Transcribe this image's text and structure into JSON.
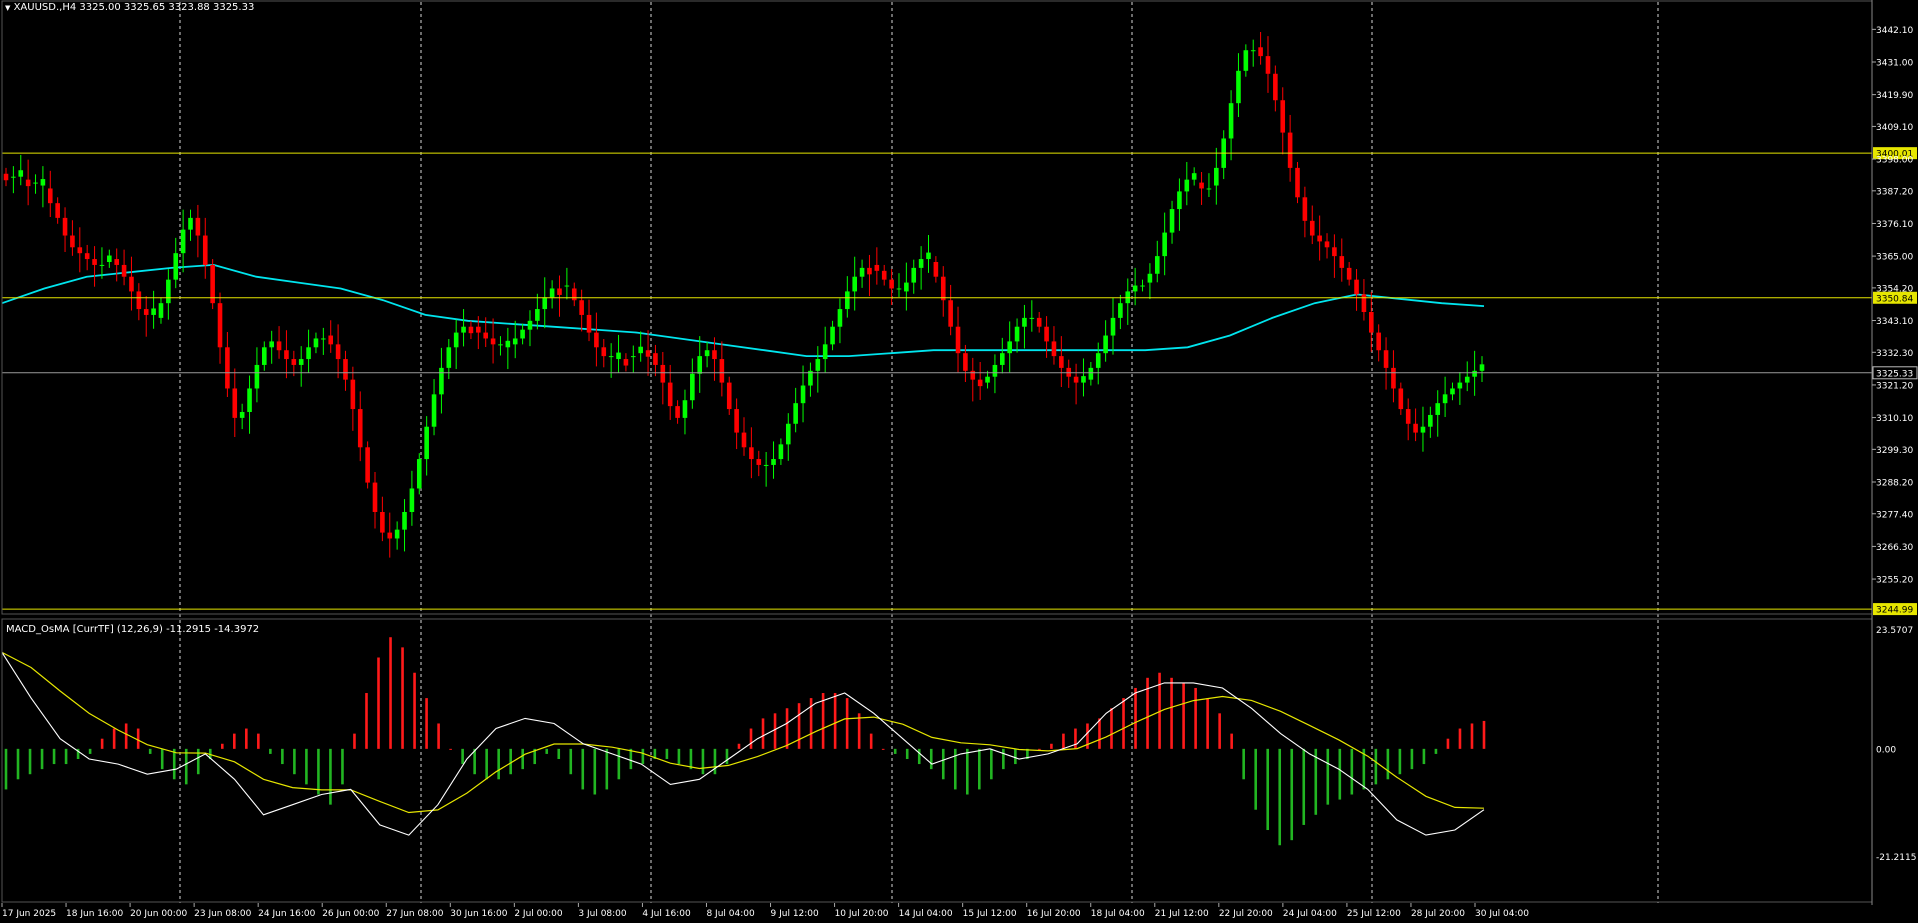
{
  "header": {
    "symbol_line": "XAUUSD.,H4  3325.00 3325.65 3323.88 3325.33",
    "indicator_line": "MACD_OsMA [CurrTF] (12,26,9) -11.2915 -14.3972"
  },
  "colors": {
    "background": "#000000",
    "bull": "#00ff00",
    "bear": "#ff0000",
    "ma": "#00e5ee",
    "level_line": "#e6e600",
    "grid": "#ffffff",
    "axis_text": "#ffffff",
    "macd_line": "#ffffff",
    "signal_line": "#e6e600",
    "hist_up": "#ff1a1a",
    "hist_down": "#22b522"
  },
  "chart_data": [
    {
      "type": "candlestick",
      "symbol": "XAUUSD.",
      "timeframe": "H4",
      "ylim": [
        3244.0,
        3448.0
      ],
      "y_ticks": [
        "3442.10",
        "3431.00",
        "3419.90",
        "3409.10",
        "3398.00",
        "3387.20",
        "3376.10",
        "3365.00",
        "3354.20",
        "3343.10",
        "3332.30",
        "3321.20",
        "3310.10",
        "3299.30",
        "3288.20",
        "3277.40",
        "3266.30",
        "3255.20"
      ],
      "x_labels": [
        "17 Jun 2025",
        "18 Jun 16:00",
        "20 Jun 00:00",
        "23 Jun 08:00",
        "24 Jun 16:00",
        "26 Jun 00:00",
        "27 Jun 08:00",
        "30 Jun 16:00",
        "2 Jul 00:00",
        "3 Jul 08:00",
        "4 Jul 16:00",
        "8 Jul 04:00",
        "9 Jul 12:00",
        "10 Jul 20:00",
        "14 Jul 04:00",
        "15 Jul 12:00",
        "16 Jul 20:00",
        "18 Jul 04:00",
        "21 Jul 12:00",
        "22 Jul 20:00",
        "24 Jul 04:00",
        "25 Jul 12:00",
        "28 Jul 20:00",
        "30 Jul 04:00"
      ],
      "horizontal_levels": [
        {
          "value": 3400.01,
          "label": "3400.01"
        },
        {
          "value": 3350.84,
          "label": "3350.84"
        },
        {
          "value": 3244.99,
          "label": "3244.99"
        }
      ],
      "current_price": {
        "value": 3325.33,
        "label": "3325.33"
      },
      "ohlc_anchors": [
        3392,
        3392,
        3391,
        3390,
        3389,
        3388,
        3383,
        3378,
        3372,
        3368,
        3366,
        3364,
        3362,
        3363,
        3364,
        3362,
        3358,
        3353,
        3347,
        3345,
        3344,
        3349,
        3357,
        3366,
        3374,
        3378,
        3372,
        3362,
        3349,
        3334,
        3320,
        3310,
        3312,
        3320,
        3328,
        3334,
        3336,
        3333,
        3330,
        3328,
        3330,
        3334,
        3337,
        3338,
        3335,
        3330,
        3323,
        3313,
        3300,
        3288,
        3278,
        3271,
        3269,
        3272,
        3278,
        3286,
        3296,
        3307,
        3318,
        3327,
        3334,
        3339,
        3341,
        3341,
        3339,
        3337,
        3335,
        3334,
        3335,
        3337,
        3340,
        3343,
        3347,
        3351,
        3354,
        3355,
        3354,
        3350,
        3345,
        3339,
        3334,
        3331,
        3330,
        3330,
        3331,
        3332,
        3333,
        3332,
        3328,
        3322,
        3314,
        3310,
        3316,
        3325,
        3331,
        3333,
        3330,
        3322,
        3313,
        3305,
        3300,
        3296,
        3294,
        3294,
        3296,
        3301,
        3308,
        3315,
        3321,
        3326,
        3330,
        3335,
        3341,
        3347,
        3353,
        3358,
        3361,
        3362,
        3360,
        3357,
        3354,
        3353,
        3356,
        3361,
        3364,
        3363,
        3358,
        3350,
        3341,
        3332,
        3326,
        3323,
        3322,
        3324,
        3328,
        3332,
        3336,
        3341,
        3344,
        3344,
        3341,
        3336,
        3331,
        3327,
        3324,
        3322,
        3323,
        3327,
        3332,
        3338,
        3344,
        3349,
        3353,
        3355,
        3356,
        3359,
        3365,
        3373,
        3381,
        3387,
        3391,
        3390,
        3388,
        3389,
        3395,
        3405,
        3417,
        3428,
        3435,
        3436,
        3433,
        3427,
        3418,
        3407,
        3395,
        3385,
        3377,
        3372,
        3370,
        3368,
        3365,
        3361,
        3357,
        3352,
        3346,
        3339,
        3333,
        3327,
        3320,
        3313,
        3308,
        3305,
        3307,
        3311,
        3315,
        3318,
        3320,
        3322,
        3324,
        3326,
        3325
      ],
      "moving_average_anchors": [
        3349,
        3354,
        3358,
        3359.5,
        3361,
        3362,
        3358,
        3356,
        3354,
        3350,
        3345,
        3343,
        3342,
        3341,
        3340,
        3339,
        3337,
        3335,
        3333,
        3331,
        3331,
        3332,
        3333,
        3333,
        3333,
        3333,
        3333,
        3333,
        3334,
        3338,
        3344,
        3349,
        3352,
        3350.5,
        3349,
        3348
      ]
    },
    {
      "type": "histogram+lines",
      "name": "MACD_OsMA [CurrTF] (12,26,9)",
      "values_shown": [
        -11.2915,
        -14.3972
      ],
      "ylim": [
        -22.5,
        25.0
      ],
      "y_ticks": [
        "23.5707",
        "0.00",
        "-21.2115"
      ],
      "histogram_anchors": [
        -8,
        -6,
        -5,
        -4,
        -3,
        -3,
        -2,
        -1,
        2,
        4,
        5,
        4,
        -1,
        -4,
        -6,
        -7,
        -5,
        -2,
        1,
        3,
        4,
        3,
        -1,
        -3,
        -5,
        -7,
        -9,
        -11,
        -7,
        3,
        11,
        18,
        22,
        20,
        15,
        10,
        5,
        0,
        -3,
        -5,
        -6,
        -6,
        -5,
        -4,
        -3,
        -1,
        -2,
        -5,
        -8,
        -9,
        -8,
        -6,
        -4,
        -3,
        -2,
        -2,
        -3,
        -4,
        -5,
        -5,
        -3,
        1,
        4,
        6,
        7,
        8,
        9,
        10,
        11,
        11,
        10,
        7,
        3,
        0,
        -1,
        -2,
        -3,
        -4,
        -6,
        -8,
        -9,
        -8,
        -6,
        -4,
        -3,
        -2,
        0,
        1,
        3,
        4,
        5,
        6,
        8,
        10,
        12,
        14,
        15,
        14,
        13,
        12,
        10,
        7,
        3,
        -6,
        -12,
        -16,
        -19,
        -18,
        -15,
        -13,
        -11,
        -10,
        -9,
        -8,
        -7,
        -6,
        -5,
        -4,
        -3,
        -1,
        2,
        4,
        5,
        5.5
      ],
      "macd_anchors": [
        19,
        10,
        2,
        -2,
        -3,
        -5,
        -4,
        -1,
        -6,
        -13,
        -11,
        -9,
        -8,
        -15,
        -17,
        -11,
        -2,
        4,
        6,
        5,
        1,
        -1,
        -3,
        -7,
        -6,
        -2,
        2,
        5,
        9,
        11,
        7,
        2,
        -3,
        -1,
        0,
        -2,
        -1,
        1,
        7,
        11,
        13,
        13,
        12,
        8,
        3,
        -1,
        -4,
        -8,
        -14,
        -17,
        -16,
        -12
      ]
    }
  ]
}
